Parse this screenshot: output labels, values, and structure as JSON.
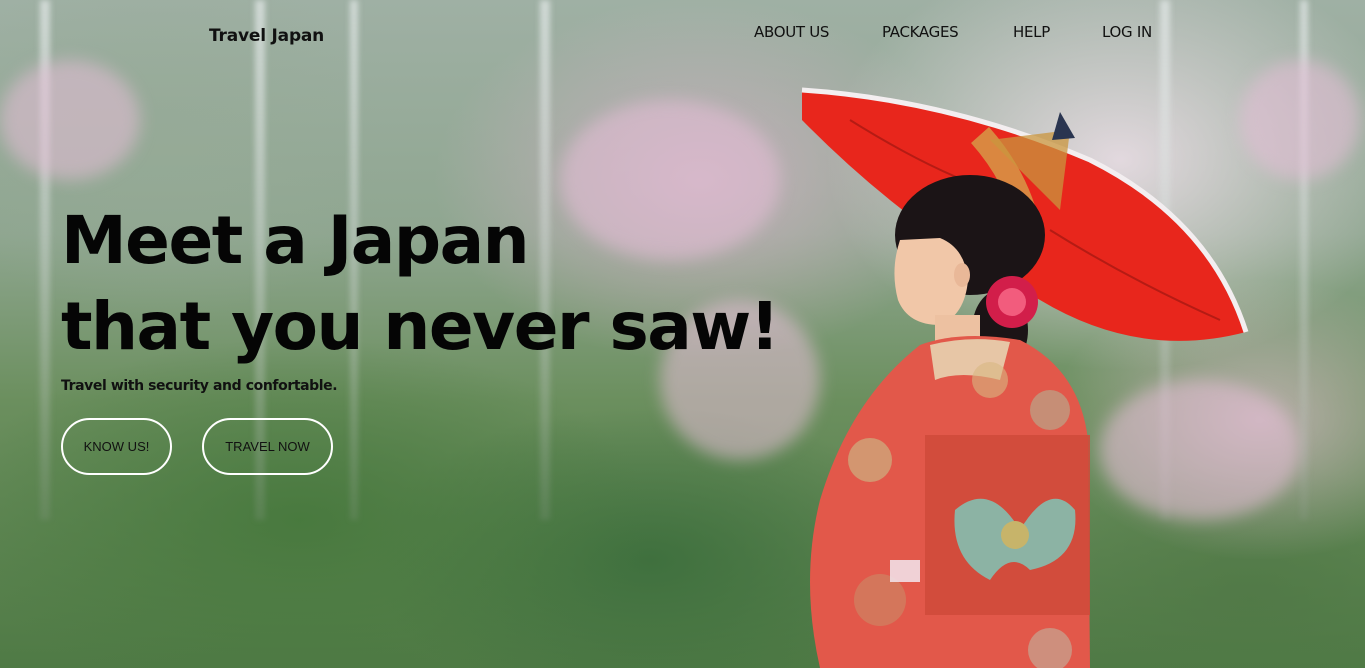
{
  "brand": "Travel Japan",
  "nav": {
    "items": [
      {
        "label": "ABOUT US"
      },
      {
        "label": "PACKAGES"
      },
      {
        "label": "HELP"
      },
      {
        "label": "LOG IN"
      }
    ]
  },
  "hero": {
    "headline_line1": "Meet a Japan",
    "headline_line2": "that you never saw!",
    "subline": "Travel with security and confortable.",
    "buttons": {
      "know_us": "KNOW US!",
      "travel_now": "TRAVEL NOW"
    }
  },
  "colors": {
    "umbrella": "#e8261c",
    "kimono": "#e2584a",
    "button_border": "#ffffff"
  }
}
